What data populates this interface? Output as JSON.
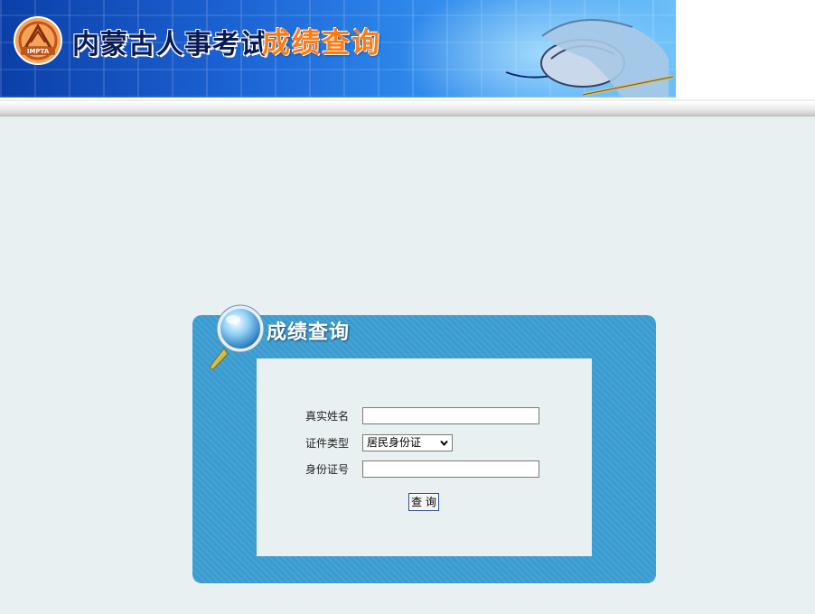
{
  "header": {
    "logo_text": "IMPTA",
    "title": "内蒙古人事考试",
    "subtitle": "成绩查询"
  },
  "panel": {
    "title": "成绩查询"
  },
  "form": {
    "name_label": "真实姓名",
    "name_value": "",
    "id_type_label": "证件类型",
    "id_type_selected": "居民身份证",
    "id_number_label": "身份证号",
    "id_number_value": "",
    "submit_label": "查 询"
  },
  "icons": [
    "impta-logo",
    "mouse-hand-image",
    "magnifier-icon",
    "chevron-down-icon"
  ],
  "colors": {
    "page_bg": "#e8f0f1",
    "panel_blue": "#3a9bd0",
    "banner_blue": "#1c63d4",
    "subtitle_orange": "#ff7a10"
  }
}
